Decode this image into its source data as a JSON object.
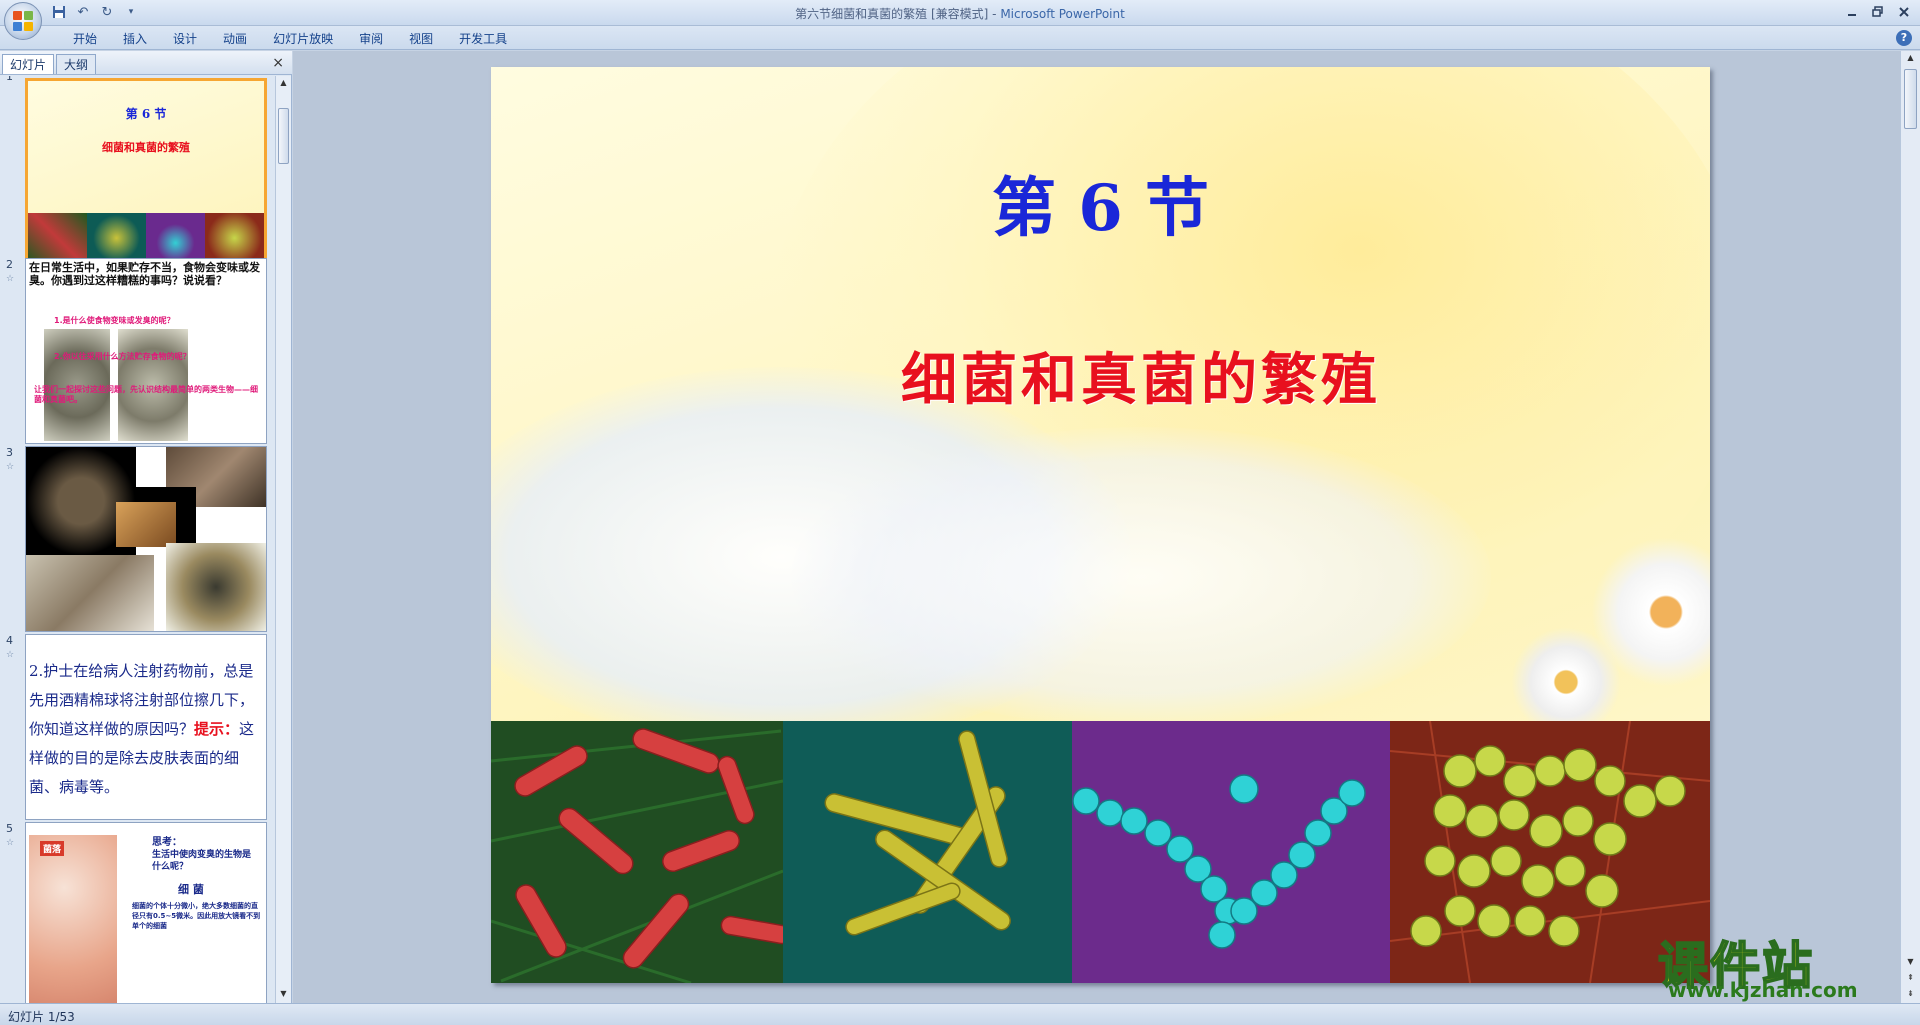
{
  "window": {
    "title_doc": "第六节细菌和真菌的繁殖 [兼容模式]",
    "title_sep": " - ",
    "title_app": "Microsoft PowerPoint"
  },
  "ribbon": {
    "tabs": [
      "开始",
      "插入",
      "设计",
      "动画",
      "幻灯片放映",
      "审阅",
      "视图",
      "开发工具"
    ]
  },
  "panel": {
    "tab_slides": "幻灯片",
    "tab_outline": "大纲",
    "close": "×"
  },
  "thumbnails": [
    {
      "num": "1",
      "title": "第 6 节",
      "subtitle": "细菌和真菌的繁殖"
    },
    {
      "num": "2",
      "text": "在日常生活中，如果贮存不当，食物会变味或发臭。你遇到过这样糟糕的事吗？说说看？",
      "q1": "1.是什么使食物变味或发臭的呢？",
      "q2": "2.你以往采用什么方法贮存食物的呢？",
      "note": "让我们一起探讨这些问题，先认识结构最简单的两类生物——细菌和真菌吧。"
    },
    {
      "num": "3"
    },
    {
      "num": "4",
      "text": "2.护士在给病人注射药物前，总是先用酒精棉球将注射部位擦几下，你知道这样做的原因吗？",
      "hint_label": "提示：",
      "hint": "这样做的目的是除去皮肤表面的细菌、病毒等。"
    },
    {
      "num": "5",
      "label": "菌落",
      "think": "思考：",
      "q": "生活中使肉变臭的生物是什么呢？",
      "heading": "细 菌",
      "desc": "细菌的个体十分微小，绝大多数细菌的直径只有0.5~5微米。因此用放大镜看不到单个的细菌"
    }
  ],
  "slide": {
    "title": "第 6 节",
    "subtitle": "细菌和真菌的繁殖"
  },
  "status": {
    "text": "幻灯片 1/53"
  },
  "watermark": {
    "cn": "课件站",
    "url": "www.kjzhan.com"
  },
  "colors": {
    "title_blue": "#1a27d8",
    "subtitle_red": "#e8101e",
    "selected_border": "#f6a632"
  }
}
